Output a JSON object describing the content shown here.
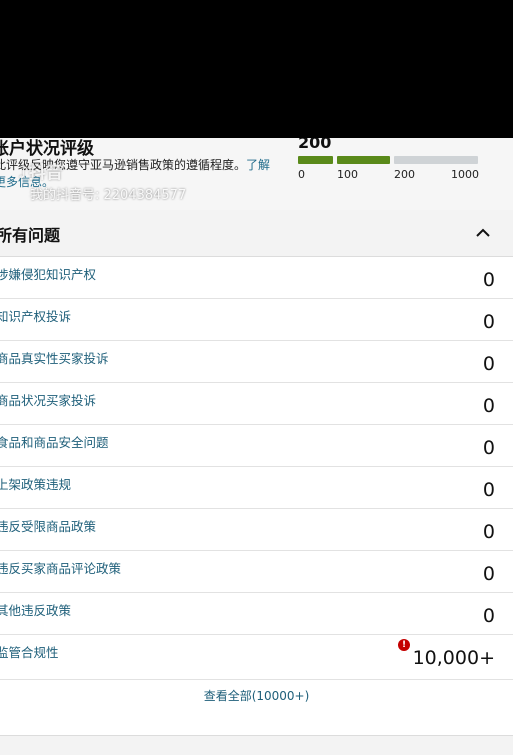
{
  "account_health": {
    "title": "账户状况评级",
    "description": "此评级反映您遵守亚马逊销售政策的遵循程度。",
    "learn_more": "了解更多信息。",
    "score": "200",
    "scale_ticks": [
      "0",
      "100",
      "200",
      "1000"
    ],
    "colors": {
      "good": "#5a8a1a",
      "remaining": "#cfd3d6"
    }
  },
  "watermark": {
    "logo": "抖音",
    "id_text": "我的抖音号: 2204384577"
  },
  "issues": {
    "title": "所有问题",
    "collapse_icon": "chevron-up-icon",
    "rows": [
      {
        "label": "涉嫌侵犯知识产权",
        "count": "0"
      },
      {
        "label": "知识产权投诉",
        "count": "0"
      },
      {
        "label": "商品真实性买家投诉",
        "count": "0"
      },
      {
        "label": "商品状况买家投诉",
        "count": "0"
      },
      {
        "label": "食品和商品安全问题",
        "count": "0"
      },
      {
        "label": "上架政策违规",
        "count": "0"
      },
      {
        "label": "违反受限商品政策",
        "count": "0"
      },
      {
        "label": "违反买家商品评论政策",
        "count": "0"
      },
      {
        "label": "其他违反政策",
        "count": "0"
      },
      {
        "label": "监管合规性",
        "count": "10,000+",
        "alert_icon": "alert-circle-icon"
      }
    ],
    "view_all": "查看全部(10000+)"
  }
}
